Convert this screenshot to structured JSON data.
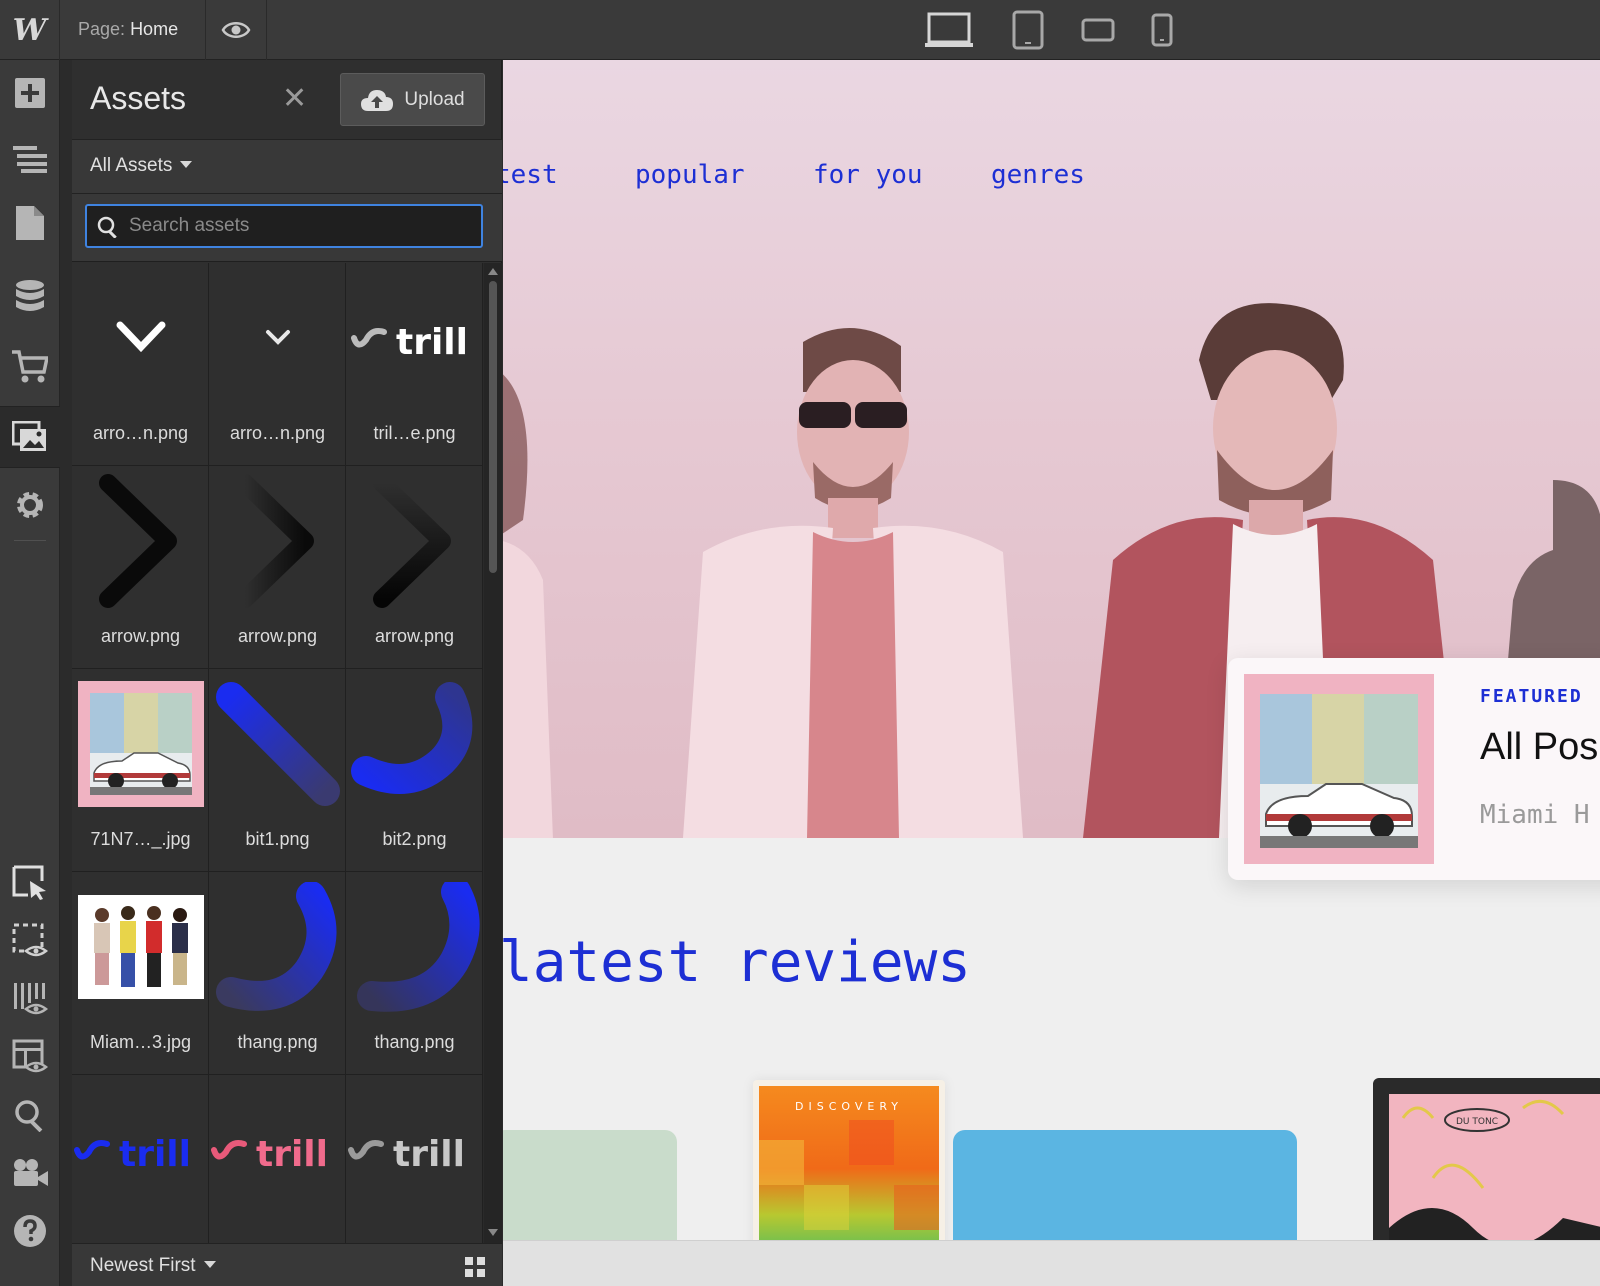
{
  "topbar": {
    "logo": "W",
    "page_prefix": "Page:",
    "page_name": "Home"
  },
  "assets_panel": {
    "title": "Assets",
    "upload_label": "Upload",
    "filter_label": "All Assets",
    "search_placeholder": "Search assets",
    "sort_label": "Newest First",
    "items": [
      {
        "name": "arro…n.png"
      },
      {
        "name": "arro…n.png"
      },
      {
        "name": "tril…e.png"
      },
      {
        "name": "arrow.png"
      },
      {
        "name": "arrow.png"
      },
      {
        "name": "arrow.png"
      },
      {
        "name": "71N7…_.jpg"
      },
      {
        "name": "bit1.png"
      },
      {
        "name": "bit2.png"
      },
      {
        "name": "Miam…3.jpg"
      },
      {
        "name": "thang.png"
      },
      {
        "name": "thang.png"
      },
      {
        "name": "",
        "logo_text": "trill"
      },
      {
        "name": "",
        "logo_text": "trill"
      },
      {
        "name": "",
        "logo_text": "trill"
      }
    ]
  },
  "canvas": {
    "nav": [
      "test",
      "popular",
      "for you",
      "genres"
    ],
    "featured_tag": "FEATURED",
    "featured_title": "All Pos",
    "featured_sub": "Miami H",
    "reviews_heading": "latest reviews",
    "discovery_label": "DISCOVERY",
    "du_tonc_label": "DU TONC"
  },
  "colors": {
    "accent": "#1d2fd4",
    "panel_bg": "#2f2f2f",
    "focus_ring": "#3f83e0",
    "hero_tint": "#e6c9d3"
  }
}
